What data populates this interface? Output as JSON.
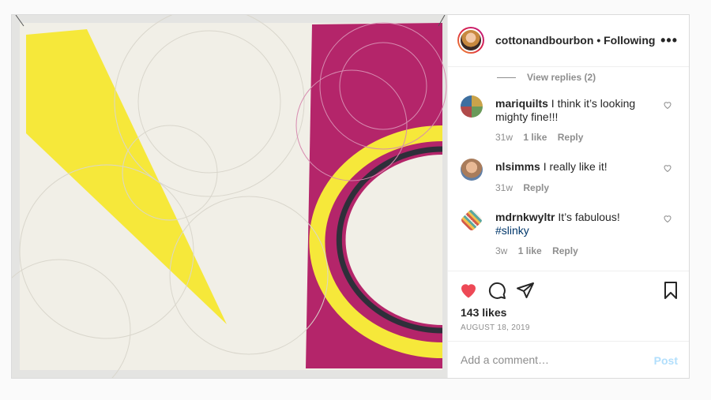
{
  "post": {
    "username": "cottonandbourbon",
    "separator": "•",
    "follow_status": "Following",
    "more_label": "•••",
    "view_replies": "View replies (2)",
    "comments": [
      {
        "user": "mariquilts",
        "text": "I think it’s looking mighty fine!!!",
        "tag": "",
        "age": "31w",
        "likes": "1 like",
        "reply": "Reply",
        "avatar_color": "#c9a34a"
      },
      {
        "user": "nlsimms",
        "text": "I really like it!",
        "tag": "",
        "age": "31w",
        "likes": "",
        "reply": "Reply",
        "avatar_color": "#a97c5b"
      },
      {
        "user": "mdrnkwyltr",
        "text": "It’s fabulous!",
        "tag": "#slinky",
        "age": "3w",
        "likes": "1 like",
        "reply": "Reply",
        "avatar_color": "#d35a4a"
      }
    ],
    "likes_count": "143 likes",
    "date": "AUGUST 18, 2019",
    "comment_placeholder": "Add a comment…",
    "post_button": "Post",
    "icons": {
      "like": "heart-filled-icon",
      "comment": "comment-bubble-icon",
      "share": "paper-plane-icon",
      "save": "bookmark-icon"
    },
    "colors": {
      "like_red": "#ed4956",
      "link_blue": "#00376b",
      "post_disabled": "#b2dffc",
      "quilt_yellow": "#f6e83a",
      "quilt_magenta": "#b4256a",
      "quilt_cream": "#f1efe7"
    }
  }
}
